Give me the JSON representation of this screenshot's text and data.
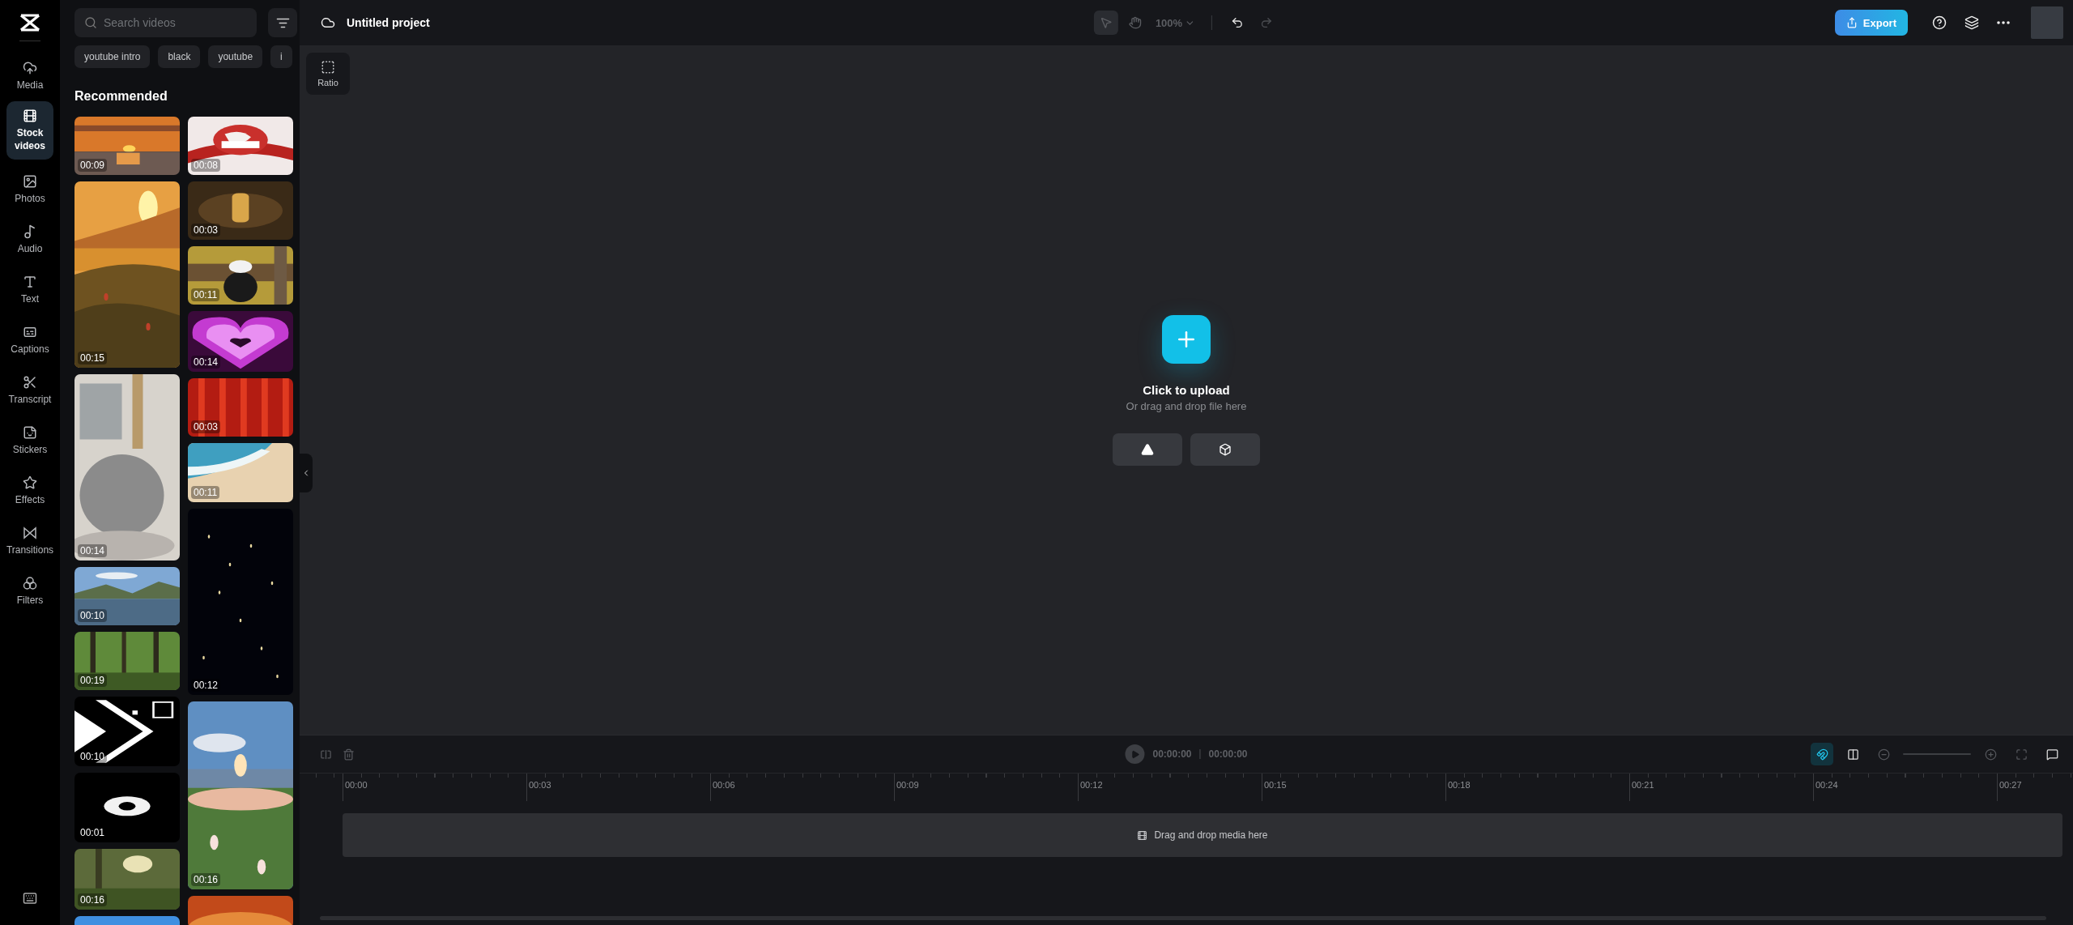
{
  "nav": {
    "items": [
      {
        "label": "Media",
        "selected": false
      },
      {
        "label": "Stock videos",
        "selected": true
      },
      {
        "label": "Photos",
        "selected": false
      },
      {
        "label": "Audio",
        "selected": false
      },
      {
        "label": "Text",
        "selected": false
      },
      {
        "label": "Captions",
        "selected": false
      },
      {
        "label": "Transcript",
        "selected": false
      },
      {
        "label": "Stickers",
        "selected": false
      },
      {
        "label": "Effects",
        "selected": false
      },
      {
        "label": "Transitions",
        "selected": false
      },
      {
        "label": "Filters",
        "selected": false
      }
    ]
  },
  "search": {
    "placeholder": "Search videos"
  },
  "chips": [
    "youtube intro",
    "black",
    "youtube",
    "i"
  ],
  "section_title": "Recommended",
  "columns": [
    [
      {
        "duration": "00:09"
      },
      {
        "duration": "00:15"
      },
      {
        "duration": "00:14"
      },
      {
        "duration": "00:10"
      },
      {
        "duration": "00:19"
      },
      {
        "duration": "00:10"
      },
      {
        "duration": "00:01"
      },
      {
        "duration": "00:16"
      },
      {}
    ],
    [
      {
        "duration": "00:08"
      },
      {
        "duration": "00:03"
      },
      {
        "duration": "00:11"
      },
      {
        "duration": "00:14"
      },
      {
        "duration": "00:03"
      },
      {
        "duration": "00:11"
      },
      {
        "duration": "00:12"
      },
      {
        "duration": "00:16"
      },
      {}
    ]
  ],
  "project": {
    "title": "Untitled project"
  },
  "tools": {
    "select_active": true,
    "zoom": "100%",
    "undo_disabled": false,
    "redo_disabled": true
  },
  "export": "Export",
  "ratio": "Ratio",
  "upload": {
    "title": "Click to upload",
    "subtitle": "Or drag and drop file here"
  },
  "timeline": {
    "current": "00:00:00",
    "total": "00:00:00",
    "magnet_on": true,
    "ruler": [
      "00:00",
      "00:03",
      "00:06",
      "00:09",
      "00:12",
      "00:15",
      "00:18",
      "00:21",
      "00:24",
      "00:27"
    ],
    "drop_hint": "Drag and drop media here"
  }
}
